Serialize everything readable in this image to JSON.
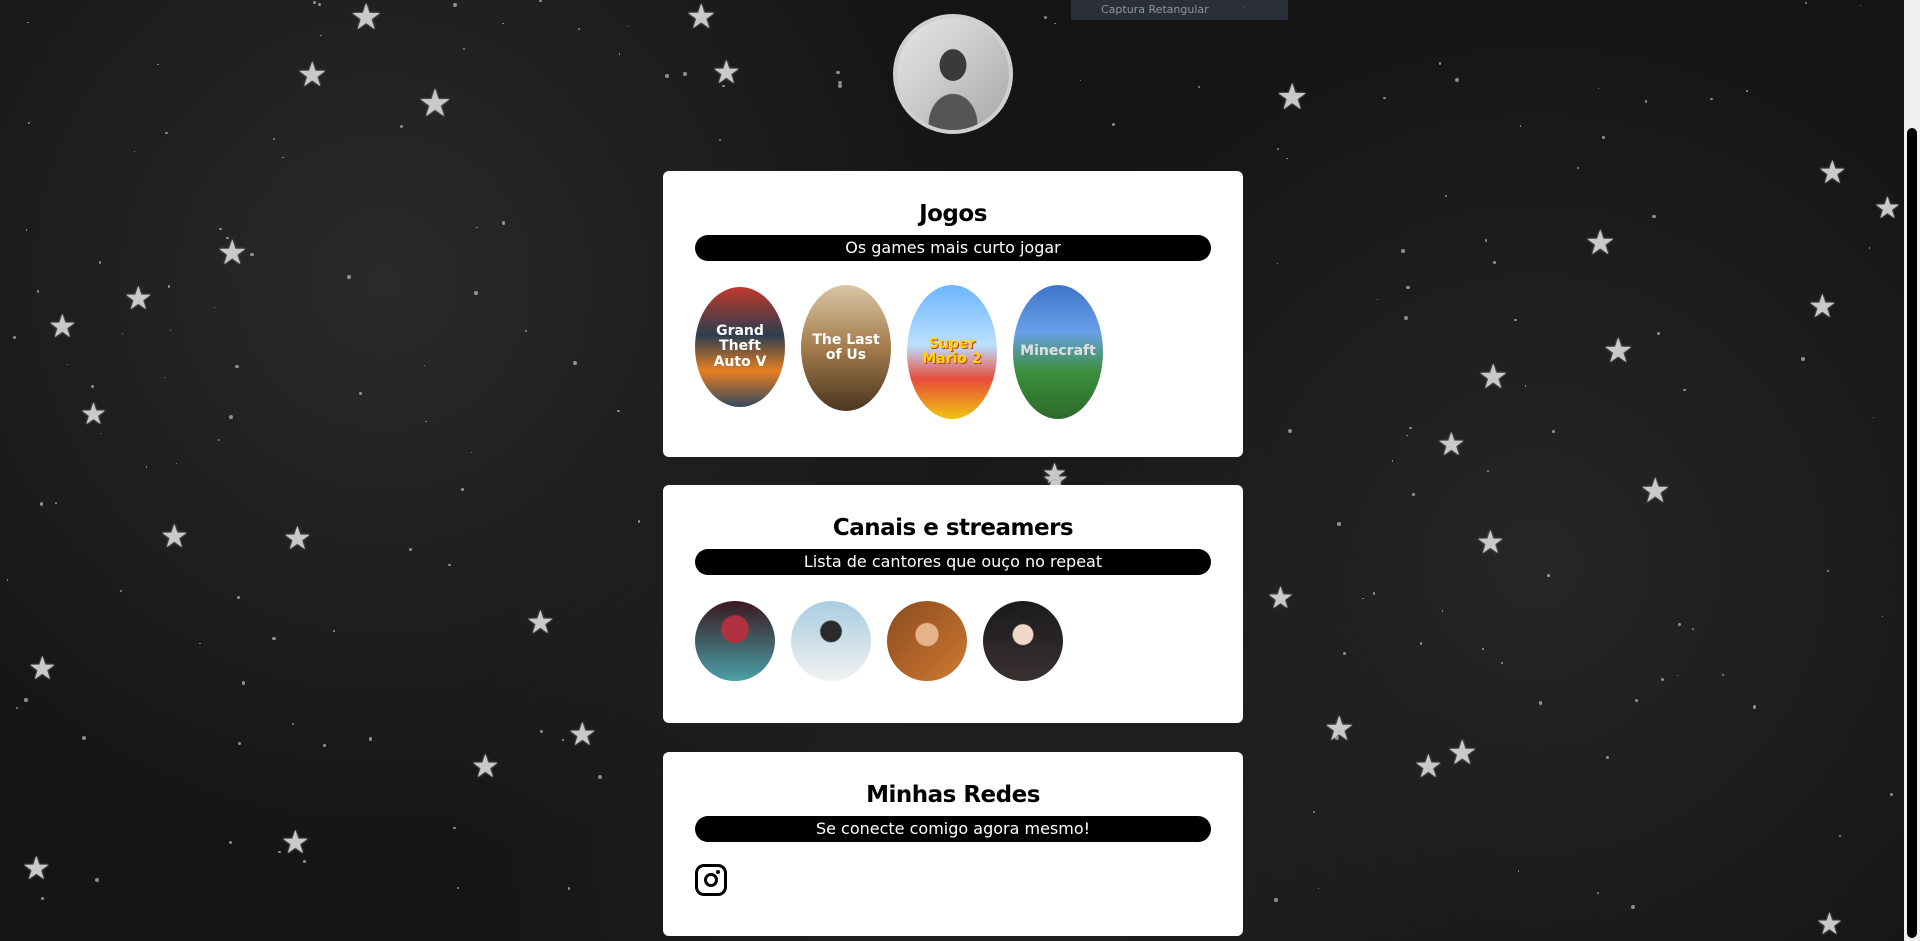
{
  "overlay": {
    "capture_label": "Captura Retangular"
  },
  "sections": {
    "games": {
      "title": "Jogos",
      "subtitle": "Os games mais curto jogar",
      "items": [
        {
          "label": "Grand Theft Auto V"
        },
        {
          "label": "The Last of Us"
        },
        {
          "label": "Super Mario 2"
        },
        {
          "label": "Minecraft"
        }
      ]
    },
    "channels": {
      "title": "Canais e streamers",
      "subtitle": "Lista de cantores que ouço no repeat"
    },
    "socials": {
      "title": "Minhas Redes",
      "subtitle": "Se conecte comigo agora mesmo!",
      "links": [
        {
          "icon": "instagram-icon"
        }
      ]
    }
  },
  "colors": {
    "background": "#151515",
    "card": "#ffffff",
    "pill": "#000000",
    "stars": "#c9c9c9"
  }
}
